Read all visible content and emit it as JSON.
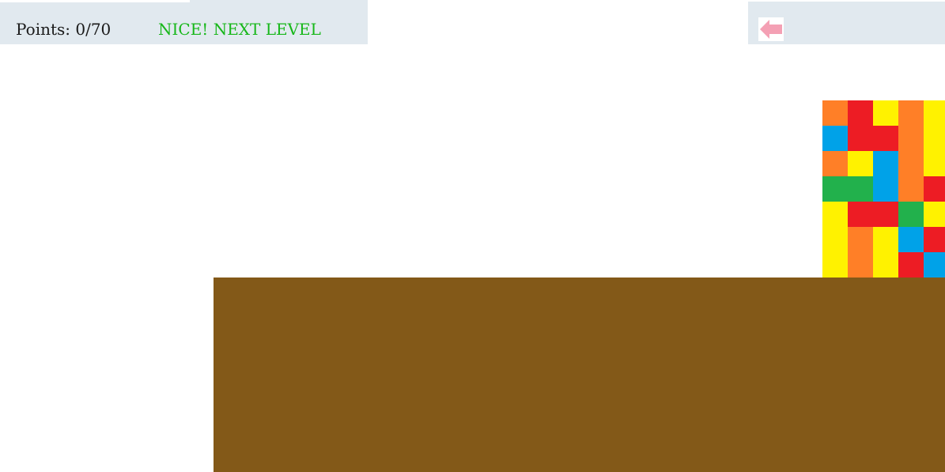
{
  "hud": {
    "points_label": "Points: 0/70",
    "status_text": "NICE! NEXT LEVEL",
    "status_color": "#17b71a"
  },
  "back_button": {
    "icon": "arrow-left-icon",
    "icon_color": "#f4a0b4"
  },
  "scene": {
    "ground_color": "#835918",
    "tower_colors": {
      "orange": "#ff7f27",
      "red": "#ed1c24",
      "yellow": "#fff200",
      "blue": "#00a2e8",
      "green": "#22b14c"
    },
    "tower_grid": [
      [
        "orange",
        "red",
        "yellow",
        "orange",
        "yellow"
      ],
      [
        "blue",
        "red",
        "red",
        "orange",
        "yellow"
      ],
      [
        "orange",
        "yellow",
        "blue",
        "orange",
        "yellow"
      ],
      [
        "green",
        "green",
        "blue",
        "orange",
        "red"
      ],
      [
        "yellow",
        "red",
        "red",
        "green",
        "yellow"
      ],
      [
        "yellow",
        "orange",
        "yellow",
        "blue",
        "red"
      ],
      [
        "yellow",
        "orange",
        "yellow",
        "red",
        "blue"
      ]
    ]
  }
}
